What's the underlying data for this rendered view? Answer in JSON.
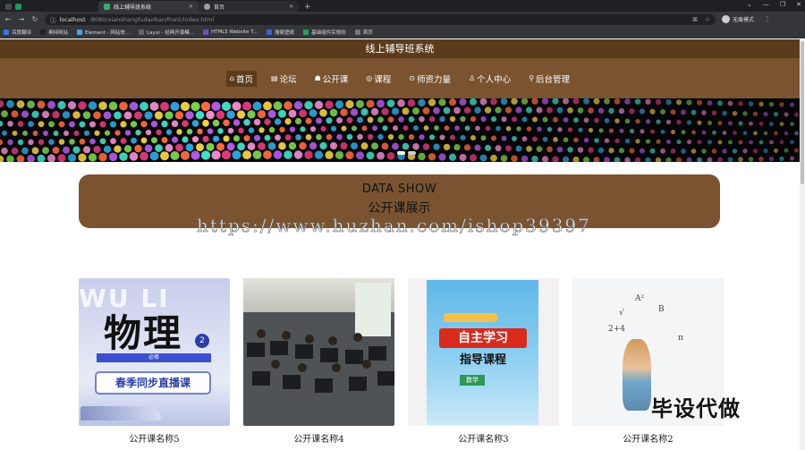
{
  "browser": {
    "tabs": [
      {
        "label": "线上辅导班系统"
      },
      {
        "label": "首页"
      }
    ],
    "new_tab": "+",
    "url_host": "localhost",
    "url_path": ":8080/xianshangfudaoban/front/index.html",
    "profile_label": "无痕模式",
    "bookmarks": [
      {
        "label": "百度翻译",
        "color": "#3b77e3"
      },
      {
        "label": "奥特网站",
        "color": "#222222"
      },
      {
        "label": "Element - 网站快...",
        "color": "#4ba3e3"
      },
      {
        "label": "Layui - 经典开源模...",
        "color": "#666666"
      },
      {
        "label": "HTML5 Website T...",
        "color": "#6b4fc7"
      },
      {
        "label": "搜索壁纸",
        "color": "#2d6cd8"
      },
      {
        "label": "基础组件实规则",
        "color": "#25a162"
      },
      {
        "label": "首页",
        "color": "#777777"
      }
    ]
  },
  "site": {
    "title": "线上辅导班系统",
    "nav": [
      {
        "icon": "⌂",
        "label": "首页",
        "active": true
      },
      {
        "icon": "▤",
        "label": "论坛"
      },
      {
        "icon": "☗",
        "label": "公开课"
      },
      {
        "icon": "◎",
        "label": "课程"
      },
      {
        "icon": "⊙",
        "label": "师资力量"
      },
      {
        "icon": "♙",
        "label": "个人中心"
      },
      {
        "icon": "⚲",
        "label": "后台管理"
      }
    ]
  },
  "section": {
    "heading_en": "DATA SHOW",
    "heading_cn": "公开课展示"
  },
  "courses": [
    {
      "name": "公开课名称5",
      "cover": {
        "bg_text": "WU LI",
        "title": "物理",
        "badge": "2",
        "bar": "必修",
        "pill": "春季同步直播课"
      }
    },
    {
      "name": "公开课名称4"
    },
    {
      "name": "公开课名称3",
      "cover": {
        "red": "自主学习",
        "sub": "指导课程",
        "green": "数学"
      }
    },
    {
      "name": "公开课名称2",
      "cover": {
        "doodles": [
          "A²",
          "B",
          "2+4",
          "π",
          "√"
        ]
      }
    }
  ],
  "overlay_watermark": "https://www.huzhan.com/ishop39397",
  "brand_watermark": "毕设代做",
  "colors": {
    "header_dark": "#5a3c1c",
    "header": "#7a5430",
    "accent": "#7a5430"
  }
}
